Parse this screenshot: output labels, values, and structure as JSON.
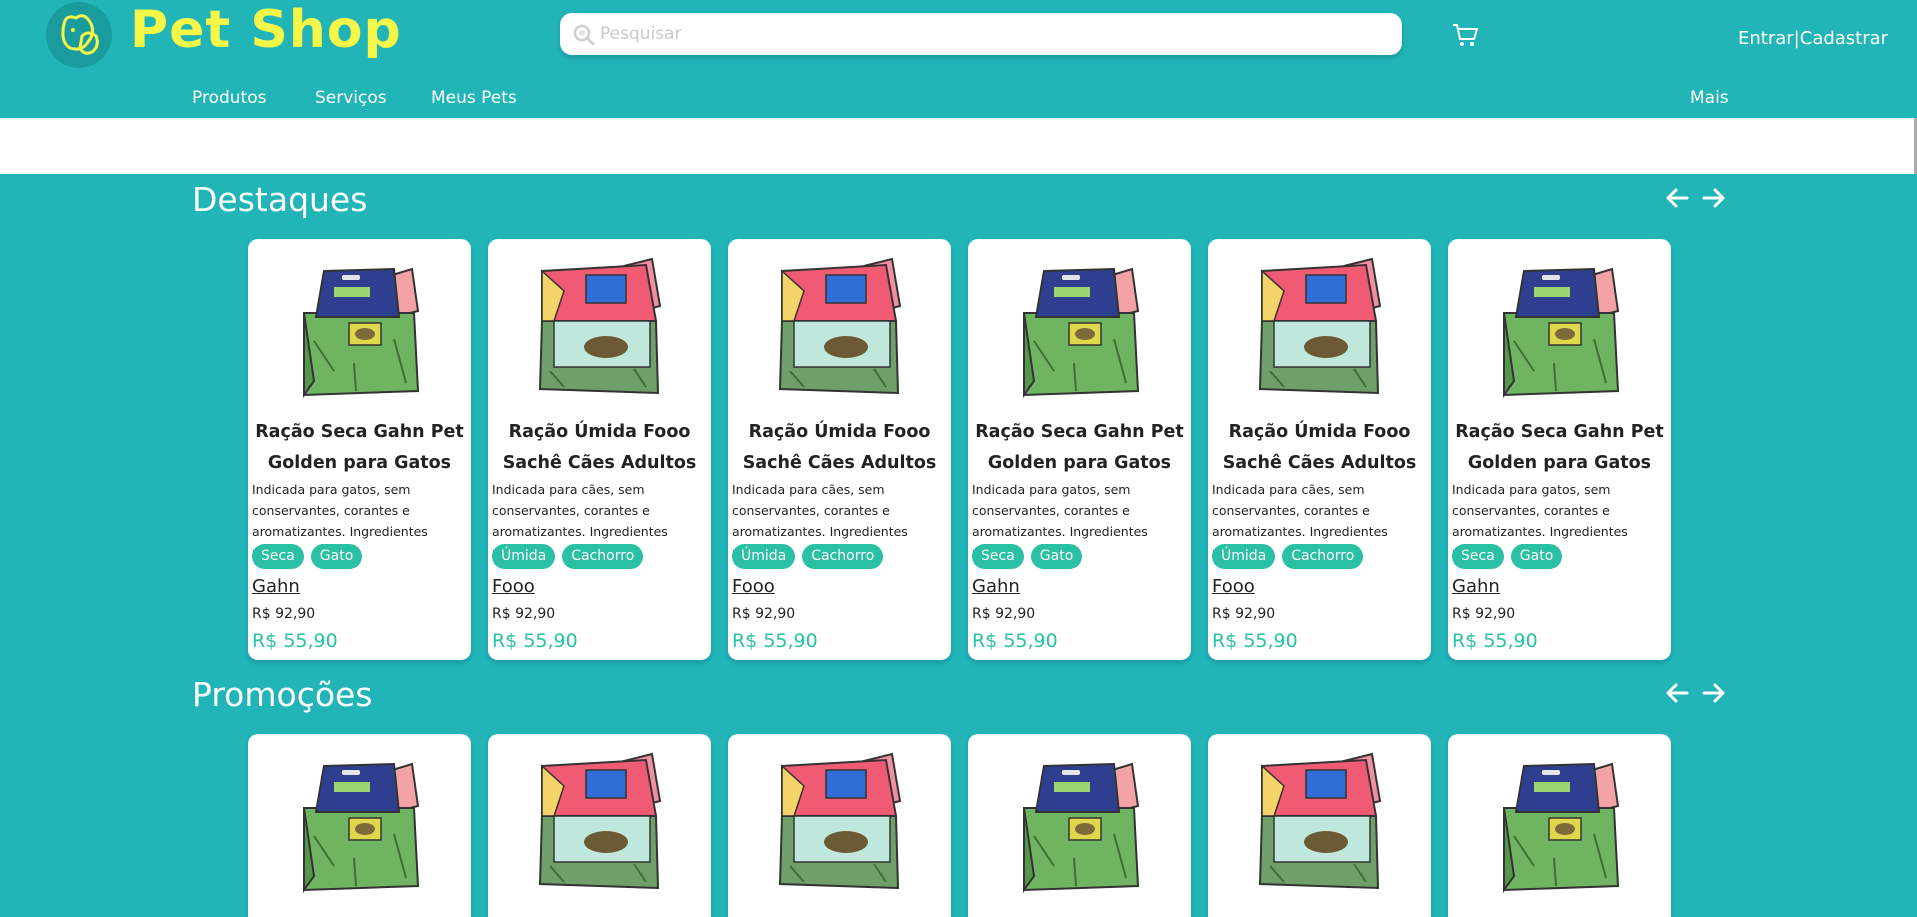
{
  "header": {
    "logo_icon": "dog-cat-logo-icon",
    "brand": "Pet Shop",
    "search_placeholder": "Pesquisar",
    "cart_icon": "cart-icon",
    "login": "Entrar",
    "separator": "|",
    "register": "Cadastrar"
  },
  "nav": {
    "products": "Produtos",
    "services": "Serviços",
    "pets": "Meus Pets",
    "more": "Mais"
  },
  "sections": {
    "featured": {
      "title": "Destaques"
    },
    "promotions": {
      "title": "Promoções"
    }
  },
  "products": [
    {
      "title": "Ração Seca Gahn Pet Golden para Gatos",
      "desc": "Indicada para gatos, sem conservantes, corantes e aromatizantes. Ingredientes naturais",
      "tag1": "Seca",
      "tag2": "Gato",
      "brand": "Gahn",
      "old_price": "R$ 92,90",
      "price": "R$ 55,90",
      "image": "green-food-bag"
    },
    {
      "title": "Ração Úmida Fooo Sachê Cães Adultos",
      "desc": "Indicada para cães, sem conservantes, corantes e aromatizantes. Ingredientes naturais",
      "tag1": "Úmida",
      "tag2": "Cachorro",
      "brand": "Fooo",
      "old_price": "R$ 92,90",
      "price": "R$ 55,90",
      "image": "pink-food-bag"
    },
    {
      "title": "Ração Úmida Fooo Sachê Cães Adultos",
      "desc": "Indicada para cães, sem conservantes, corantes e aromatizantes. Ingredientes naturais",
      "tag1": "Úmida",
      "tag2": "Cachorro",
      "brand": "Fooo",
      "old_price": "R$ 92,90",
      "price": "R$ 55,90",
      "image": "pink-food-bag"
    },
    {
      "title": "Ração Seca Gahn Pet Golden para Gatos",
      "desc": "Indicada para gatos, sem conservantes, corantes e aromatizantes. Ingredientes naturais",
      "tag1": "Seca",
      "tag2": "Gato",
      "brand": "Gahn",
      "old_price": "R$ 92,90",
      "price": "R$ 55,90",
      "image": "green-food-bag"
    },
    {
      "title": "Ração Úmida Fooo Sachê Cães Adultos",
      "desc": "Indicada para cães, sem conservantes, corantes e aromatizantes. Ingredientes naturais",
      "tag1": "Úmida",
      "tag2": "Cachorro",
      "brand": "Fooo",
      "old_price": "R$ 92,90",
      "price": "R$ 55,90",
      "image": "pink-food-bag"
    },
    {
      "title": "Ração Seca Gahn Pet Golden para Gatos",
      "desc": "Indicada para gatos, sem conservantes, corantes e aromatizantes. Ingredientes naturais",
      "tag1": "Seca",
      "tag2": "Gato",
      "brand": "Gahn",
      "old_price": "R$ 92,90",
      "price": "R$ 55,90",
      "image": "green-food-bag"
    }
  ],
  "promotion_images": [
    "green-food-bag",
    "pink-food-bag",
    "pink-food-bag",
    "green-food-bag",
    "pink-food-bag",
    "green-food-bag"
  ],
  "colors": {
    "background": "#21b5b7",
    "brand_yellow": "#f4f648",
    "tag_green": "#29c0a3",
    "price_green": "#29c0a3"
  }
}
